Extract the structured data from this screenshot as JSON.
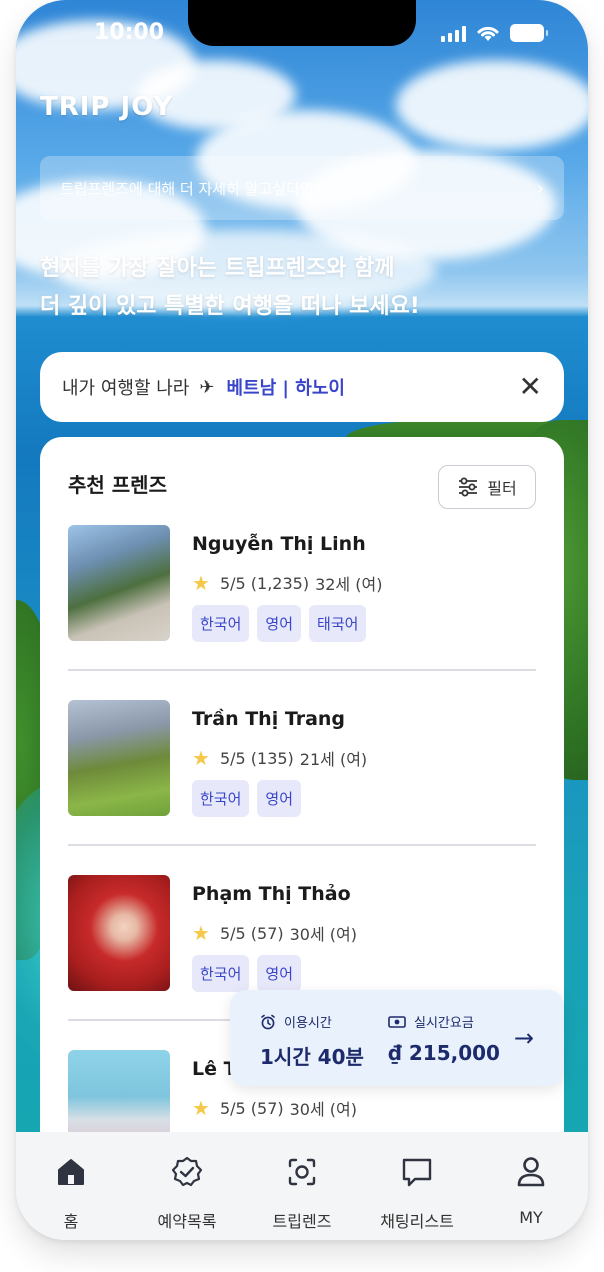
{
  "status_bar": {
    "time": "10:00"
  },
  "app": {
    "logo": "TRIP JOY"
  },
  "banner": {
    "text": "트립프렌즈에 대해 더 자세히 알고싶다면?"
  },
  "headline": {
    "line1": "현지를 가장 잘아는 트립프렌즈와 함께",
    "line2": "더 깊이 있고 특별한 여행을 떠나 보세요!"
  },
  "destination": {
    "label": "내가 여행할 나라",
    "value": "베트남 | 하노이"
  },
  "recommend": {
    "title": "추천 프렌즈",
    "filter_label": "필터",
    "friends": [
      {
        "name": "Nguyễn Thị Linh",
        "rating": "5/5 (1,235)",
        "age": "32세 (여)",
        "languages": [
          "한국어",
          "영어",
          "태국어"
        ]
      },
      {
        "name": "Trần Thị Trang",
        "rating": "5/5 (135)",
        "age": "21세 (여)",
        "languages": [
          "한국어",
          "영어"
        ]
      },
      {
        "name": "Phạm Thị Thảo",
        "rating": "5/5 (57)",
        "age": "30세 (여)",
        "languages": [
          "한국어",
          "영어"
        ]
      },
      {
        "name": "Lê T",
        "rating": "5/5 (57)",
        "age": "30세 (여)",
        "languages": []
      }
    ]
  },
  "booking_bar": {
    "usage_label": "이용시간",
    "usage_value": "1시간 40분",
    "price_label": "실시간요금",
    "price_value": "₫ 215,000"
  },
  "tabbar": {
    "items": [
      {
        "label": "홈",
        "icon": "home-icon"
      },
      {
        "label": "예약목록",
        "icon": "badge-check-icon"
      },
      {
        "label": "트립렌즈",
        "icon": "camera-scan-icon"
      },
      {
        "label": "채팅리스트",
        "icon": "chat-icon"
      },
      {
        "label": "MY",
        "icon": "user-icon"
      }
    ]
  },
  "colors": {
    "accent": "#3a46c9",
    "tag_bg": "#e7e9fb",
    "star": "#f6c84a",
    "navy": "#1d2a6b"
  }
}
